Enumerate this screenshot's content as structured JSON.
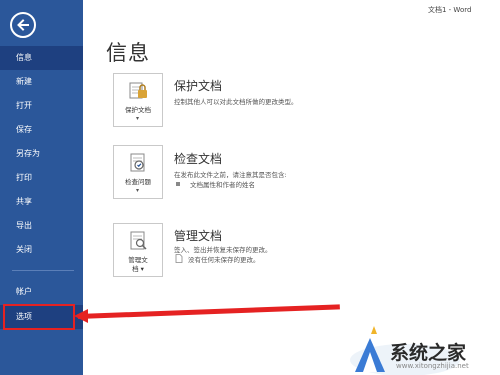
{
  "window": {
    "title": "文档1 - Word"
  },
  "sidebar": {
    "items": [
      {
        "label": "信息"
      },
      {
        "label": "新建"
      },
      {
        "label": "打开"
      },
      {
        "label": "保存"
      },
      {
        "label": "另存为"
      },
      {
        "label": "打印"
      },
      {
        "label": "共享"
      },
      {
        "label": "导出"
      },
      {
        "label": "关闭"
      },
      {
        "label": "帐户"
      },
      {
        "label": "选项"
      }
    ],
    "active_index": 0
  },
  "main": {
    "title": "信息",
    "sections": [
      {
        "button_label": "保护文档",
        "button_caret": "▾",
        "title": "保护文档",
        "description": "控制其他人可以对此文档所做的更改类型。"
      },
      {
        "button_label": "检查问题",
        "button_caret": "▾",
        "title": "检查文档",
        "description": "在发布此文件之前，请注意其是否包含:",
        "bullets": [
          "文档属性和作者的姓名"
        ]
      },
      {
        "button_label": "管理文",
        "button_label2": "档 ▾",
        "title": "管理文档",
        "description": "签入、签出并恢复未保存的更改。",
        "extra": "没有任何未保存的更改。"
      }
    ]
  },
  "watermark": {
    "text": "系统之家",
    "sub": "www.xitongzhijia.net"
  },
  "colors": {
    "sidebar_bg": "#2b579a",
    "accent_red": "#e52222"
  }
}
